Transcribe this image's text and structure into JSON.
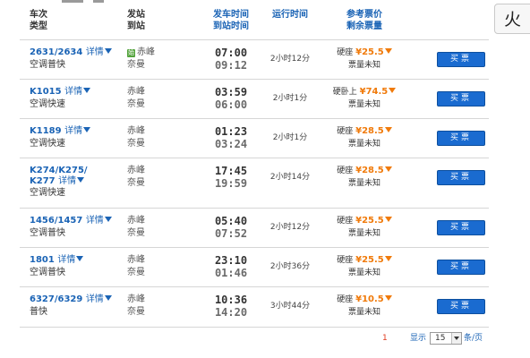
{
  "header": {
    "train_l1": "车次",
    "train_l2": "类型",
    "station_l1": "发站",
    "station_l2": "到站",
    "time_l1": "发车时间",
    "time_l2": "到站时间",
    "run_l1": "运行时间",
    "price_l1": "参考票价",
    "price_l2": "剩余票量"
  },
  "side_box_text": "火",
  "trains": [
    {
      "code": "2631/2634",
      "detail": "详情",
      "type": "空调普快",
      "from": "赤峰",
      "from_badge": "始",
      "to": "奈曼",
      "depart": "07:00",
      "arrive": "09:12",
      "duration": "2小时12分",
      "seat": "硬座",
      "price": "¥25.5",
      "remaining": "票量未知",
      "buy": "买票"
    },
    {
      "code": "K1015",
      "detail": "详情",
      "type": "空调快速",
      "from": "赤峰",
      "to": "奈曼",
      "depart": "03:59",
      "arrive": "06:00",
      "duration": "2小时1分",
      "seat": "硬卧上",
      "price": "¥74.5",
      "remaining": "票量未知",
      "buy": "买票"
    },
    {
      "code": "K1189",
      "detail": "详情",
      "type": "空调快速",
      "from": "赤峰",
      "to": "奈曼",
      "depart": "01:23",
      "arrive": "03:24",
      "duration": "2小时1分",
      "seat": "硬座",
      "price": "¥28.5",
      "remaining": "票量未知",
      "buy": "买票"
    },
    {
      "code": "K274/K275/",
      "code2": "K277",
      "detail": "详情",
      "type": "空调快速",
      "from": "赤峰",
      "to": "奈曼",
      "depart": "17:45",
      "arrive": "19:59",
      "duration": "2小时14分",
      "seat": "硬座",
      "price": "¥28.5",
      "remaining": "票量未知",
      "buy": "买票"
    },
    {
      "code": "1456/1457",
      "detail": "详情",
      "type": "空调普快",
      "from": "赤峰",
      "to": "奈曼",
      "depart": "05:40",
      "arrive": "07:52",
      "duration": "2小时12分",
      "seat": "硬座",
      "price": "¥25.5",
      "remaining": "票量未知",
      "buy": "买票"
    },
    {
      "code": "1801",
      "detail": "详情",
      "type": "空调普快",
      "from": "赤峰",
      "to": "奈曼",
      "depart": "23:10",
      "arrive": "01:46",
      "duration": "2小时36分",
      "seat": "硬座",
      "price": "¥25.5",
      "remaining": "票量未知",
      "buy": "买票"
    },
    {
      "code": "6327/6329",
      "detail": "详情",
      "type": "普快",
      "from": "赤峰",
      "to": "奈曼",
      "depart": "10:36",
      "arrive": "14:20",
      "duration": "3小时44分",
      "seat": "硬座",
      "price": "¥10.5",
      "remaining": "票量未知",
      "buy": "买票"
    }
  ],
  "pagination": {
    "current_page": "1",
    "show_label": "显示",
    "page_size": "15",
    "per_page_label": "条/页"
  },
  "colors": {
    "link_blue": "#1a63b5",
    "price_orange": "#f07a0a",
    "button_blue": "#1a6bd0",
    "page_red": "#e03a1e"
  }
}
